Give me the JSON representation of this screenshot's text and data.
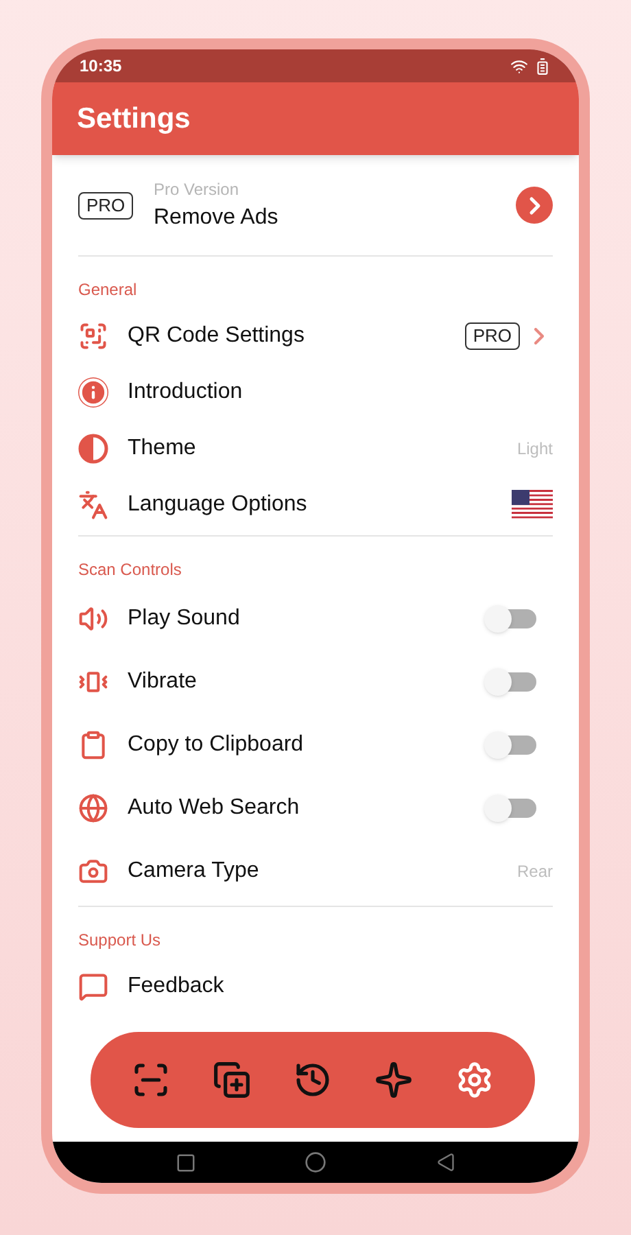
{
  "status_bar": {
    "time": "10:35"
  },
  "header": {
    "title": "Settings"
  },
  "pro_card": {
    "badge": "PRO",
    "label": "Pro Version",
    "title": "Remove Ads"
  },
  "sections": [
    {
      "title": "General",
      "items": [
        {
          "kind": "pro",
          "label": "QR Code Settings",
          "badge": "PRO"
        },
        {
          "kind": "plain",
          "label": "Introduction"
        },
        {
          "kind": "value",
          "label": "Theme",
          "value": "Light"
        },
        {
          "kind": "flag",
          "label": "Language Options"
        }
      ]
    },
    {
      "title": "Scan Controls",
      "items": [
        {
          "kind": "toggle",
          "label": "Play Sound",
          "on": false
        },
        {
          "kind": "toggle",
          "label": "Vibrate",
          "on": false
        },
        {
          "kind": "toggle",
          "label": "Copy to Clipboard",
          "on": false
        },
        {
          "kind": "toggle",
          "label": "Auto Web Search",
          "on": false
        },
        {
          "kind": "value",
          "label": "Camera Type",
          "value": "Rear"
        }
      ]
    },
    {
      "title": "Support Us",
      "items": [
        {
          "kind": "plain",
          "label": "Feedback"
        }
      ]
    }
  ],
  "bottom_nav": [
    {
      "selected": false
    },
    {
      "selected": false
    },
    {
      "selected": false
    },
    {
      "selected": false
    },
    {
      "selected": true
    }
  ]
}
